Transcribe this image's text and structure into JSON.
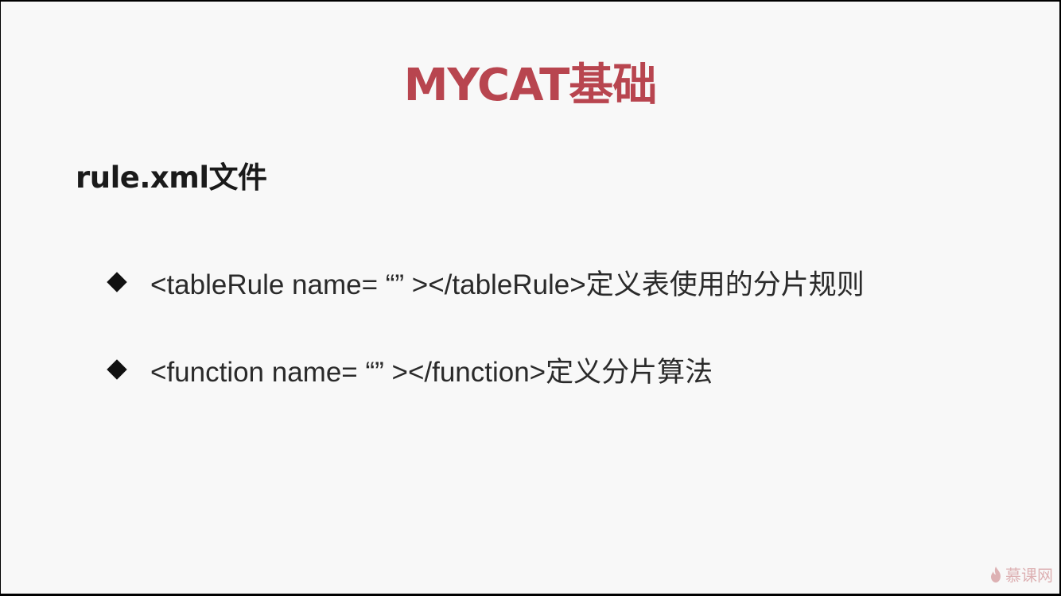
{
  "slide": {
    "title": "MYCAT基础",
    "subtitle": "rule.xml文件",
    "bullets": [
      {
        "icon": "diamond-bullet-icon",
        "text": "<tableRule name= “” ></tableRule>定义表使用的分片规则"
      },
      {
        "icon": "diamond-bullet-icon",
        "text": "<function name= “” ></function>定义分片算法"
      }
    ],
    "watermark": "慕课网"
  },
  "colors": {
    "title": "#b8454f",
    "background": "#f8f8f8",
    "text": "#2a2a2a"
  }
}
